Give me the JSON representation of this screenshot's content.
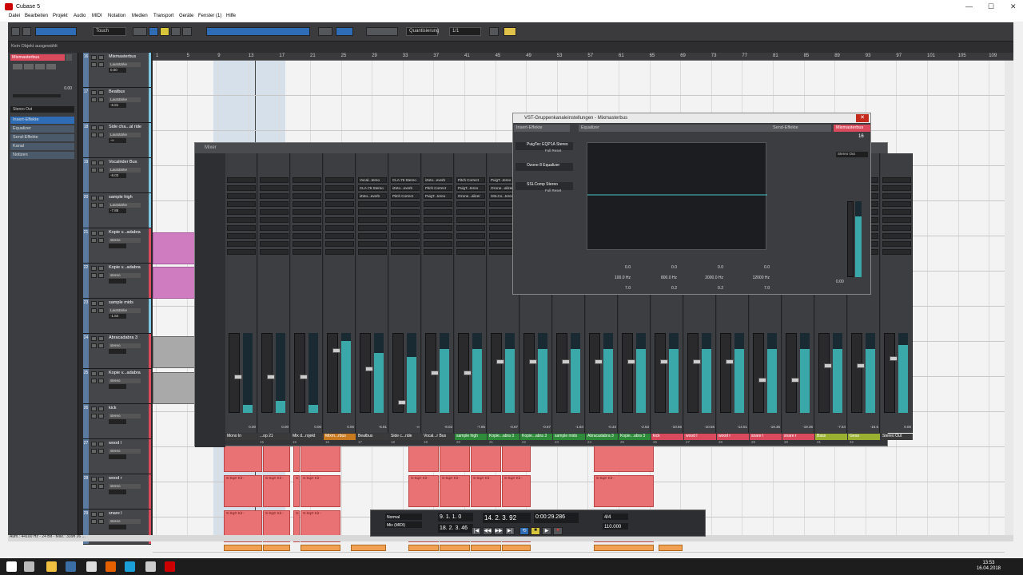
{
  "window": {
    "title": "Cubase 5",
    "min": "—",
    "max": "☐",
    "close": "✕"
  },
  "menu": [
    "Datei",
    "Bearbeiten",
    "Projekt",
    "Audio",
    "MIDI",
    "Notation",
    "Medien",
    "Transport",
    "Geräte",
    "Fenster (1)",
    "Hilfe"
  ],
  "toolbar": {
    "automation_mode": "Touch",
    "quantize_type": "Quantisierung",
    "quantize_value": "1/1"
  },
  "status_text": "Kein Objekt ausgewählt",
  "inspector": {
    "track_name": "Mixmasterbus",
    "value": "0.00",
    "output": "Stereo Out",
    "sections": [
      "Insert-Effekte",
      "Equalizer",
      "Send-Effekte",
      "Kanal",
      "Notizen"
    ]
  },
  "ruler": [
    "1",
    "5",
    "9",
    "13",
    "17",
    "21",
    "25",
    "29",
    "33",
    "37",
    "41",
    "45",
    "49",
    "53",
    "57",
    "61",
    "65",
    "69",
    "73",
    "77",
    "81",
    "85",
    "89",
    "93",
    "97",
    "101",
    "105",
    "109"
  ],
  "tracks": [
    {
      "num": "16",
      "name": "Mixmasterbus",
      "vol_label": "Lautstärke",
      "value": "0.00",
      "color": "#7ec8e3"
    },
    {
      "num": "17",
      "name": "Beatbus",
      "vol_label": "Lautstärke",
      "value": "-6.81",
      "color": "#7ec8e3"
    },
    {
      "num": "18",
      "name": "Side cha...al ride",
      "vol_label": "Lautstärke",
      "value": "-∞",
      "color": "#7ec8e3"
    },
    {
      "num": "19",
      "name": "Vocalrider Bus",
      "vol_label": "Lautstärke",
      "value": "-8.03",
      "color": "#7ec8e3"
    },
    {
      "num": "20",
      "name": "sample high",
      "vol_label": "Lautstärke",
      "value": "-7.85",
      "color": "#7ec8e3"
    },
    {
      "num": "21",
      "name": "Kopie v...adabra",
      "vol_label": "stereo",
      "value": "",
      "color": "#d94b5c"
    },
    {
      "num": "22",
      "name": "Kopie v...adabra",
      "vol_label": "stereo",
      "value": "",
      "color": "#d94b5c"
    },
    {
      "num": "23",
      "name": "sample mids",
      "vol_label": "Lautstärke",
      "value": "-1.84",
      "color": "#7ec8e3"
    },
    {
      "num": "24",
      "name": "Abracadabra 3",
      "vol_label": "stereo",
      "value": "",
      "color": "#d94b5c"
    },
    {
      "num": "25",
      "name": "Kopie v...adabra",
      "vol_label": "stereo",
      "value": "",
      "color": "#d94b5c"
    },
    {
      "num": "26",
      "name": "kick",
      "vol_label": "stereo",
      "value": "",
      "color": "#d94b5c"
    },
    {
      "num": "27",
      "name": "wood l",
      "vol_label": "stereo",
      "value": "",
      "color": "#d94b5c"
    },
    {
      "num": "28",
      "name": "wood r",
      "vol_label": "stereo",
      "value": "",
      "color": "#d94b5c"
    },
    {
      "num": "29",
      "name": "snare l",
      "vol_label": "stereo",
      "value": "",
      "color": "#d94b5c"
    }
  ],
  "clip_label": "S-Sqz! Kit -",
  "mixer": {
    "title": "Mixer",
    "strips": [
      {
        "label": "Mono In",
        "num": "",
        "vol": "0.00",
        "color": "#3a3a3a",
        "fader": 0.55,
        "meter": 0.1
      },
      {
        "label": "...op 21",
        "num": "15",
        "vol": "0.00",
        "color": "#3a3a3a",
        "fader": 0.55,
        "meter": 0.15
      },
      {
        "label": "Mix d...rojekt",
        "num": "15",
        "vol": "0.00",
        "color": "#3a3a3a",
        "fader": 0.55,
        "meter": 0.1
      },
      {
        "label": "Mixm...rbus",
        "num": "16",
        "vol": "0.00",
        "color": "#c87a20",
        "fader": 0.2,
        "meter": 0.9
      },
      {
        "label": "Beatbus",
        "num": "17",
        "vol": "-6.81",
        "color": "#3a3a3a",
        "fader": 0.45,
        "meter": 0.75
      },
      {
        "label": "Side c...ride",
        "num": "18",
        "vol": "-∞",
        "color": "#3a3a3a",
        "fader": 0.9,
        "meter": 0.7
      },
      {
        "label": "Vocal...r Bus",
        "num": "19",
        "vol": "-8.03",
        "color": "#3a3a3a",
        "fader": 0.5,
        "meter": 0.8
      },
      {
        "label": "sample high",
        "num": "20",
        "vol": "-7.85",
        "color": "#2e8b3a",
        "fader": 0.5,
        "meter": 0.8
      },
      {
        "label": "Kopie...abra 3",
        "num": "21",
        "vol": "-0.67",
        "color": "#2e8b3a",
        "fader": 0.35,
        "meter": 0.8
      },
      {
        "label": "Kopie...abra 3",
        "num": "22",
        "vol": "-0.67",
        "color": "#2e8b3a",
        "fader": 0.35,
        "meter": 0.8
      },
      {
        "label": "sample mids",
        "num": "23",
        "vol": "-1.84",
        "color": "#2e8b3a",
        "fader": 0.35,
        "meter": 0.8
      },
      {
        "label": "Abracadabra 3",
        "num": "24",
        "vol": "-0.34",
        "color": "#2e8b3a",
        "fader": 0.35,
        "meter": 0.8
      },
      {
        "label": "Kopie...abra 3",
        "num": "25",
        "vol": "-2.53",
        "color": "#2e8b3a",
        "fader": 0.35,
        "meter": 0.8
      },
      {
        "label": "kick",
        "num": "26",
        "vol": "-10.56",
        "color": "#d94b5c",
        "fader": 0.35,
        "meter": 0.8
      },
      {
        "label": "wood l",
        "num": "27",
        "vol": "-10.56",
        "color": "#d94b5c",
        "fader": 0.35,
        "meter": 0.8
      },
      {
        "label": "wood r",
        "num": "28",
        "vol": "-14.51",
        "color": "#d94b5c",
        "fader": 0.35,
        "meter": 0.8
      },
      {
        "label": "snare l",
        "num": "29",
        "vol": "-19.36",
        "color": "#d94b5c",
        "fader": 0.6,
        "meter": 0.8
      },
      {
        "label": "snare r",
        "num": "30",
        "vol": "-19.36",
        "color": "#d94b5c",
        "fader": 0.6,
        "meter": 0.8
      },
      {
        "label": "Bass",
        "num": "31",
        "vol": "-7.54",
        "color": "#9ab030",
        "fader": 0.4,
        "meter": 0.8
      },
      {
        "label": "Gesa",
        "num": "32",
        "vol": "-15.5",
        "color": "#9ab030",
        "fader": 0.4,
        "meter": 0.8
      },
      {
        "label": "Stereo Out",
        "num": "",
        "vol": "0.00",
        "color": "#3a3a3a",
        "fader": 0.3,
        "meter": 0.85
      }
    ],
    "inserts": [
      "PuigT...tereo",
      "Ozone...alizer",
      "SSLCo...tereo",
      "S1 Im...tereo",
      "Vocal...tereo",
      "CLA-76 Stereo",
      "iZoto...everb",
      "Pitch Correct"
    ]
  },
  "vst": {
    "title": "VST-Gruppenkanaleinstellungen - Mixmasterbus",
    "sec_insert": "Insert-Effekte",
    "sec_eq": "Equalizer",
    "sec_send": "Send-Effekte",
    "channel": "Mixmasterbus",
    "channel_num": "16",
    "inserts": [
      {
        "name": "PuigTec EQP1A Stereo",
        "preset": "Full Reset"
      },
      {
        "name": "Ozone 8 Equalizer",
        "preset": ""
      },
      {
        "name": "SSLComp Stereo",
        "preset": "Full Reset"
      }
    ],
    "bands": [
      {
        "gain": "0.0",
        "freq": "100.0 Hz",
        "q": "7.0"
      },
      {
        "gain": "0.0",
        "freq": "800.0 Hz",
        "q": "0.2"
      },
      {
        "gain": "0.0",
        "freq": "2000.0 Hz",
        "q": "0.2"
      },
      {
        "gain": "0.0",
        "freq": "12000 Hz",
        "q": "7.0"
      }
    ],
    "output": "Stereo Out",
    "vol": "0.00"
  },
  "transport": {
    "mode": "Normal",
    "mix_mode": "Mix (MIDI)",
    "left_locator": "9. 1. 1. 0",
    "right_locator": "18. 2. 3. 46",
    "position": "14. 2. 3. 92",
    "time": "0:00:29.286",
    "tempo": "110.000",
    "signature": "4/4"
  },
  "project_info": "Aufn.: 44100 Hz - 24 Bit - Max.: 339h 26 ...",
  "clock": {
    "time": "13:53",
    "date": "16.04.2018"
  }
}
